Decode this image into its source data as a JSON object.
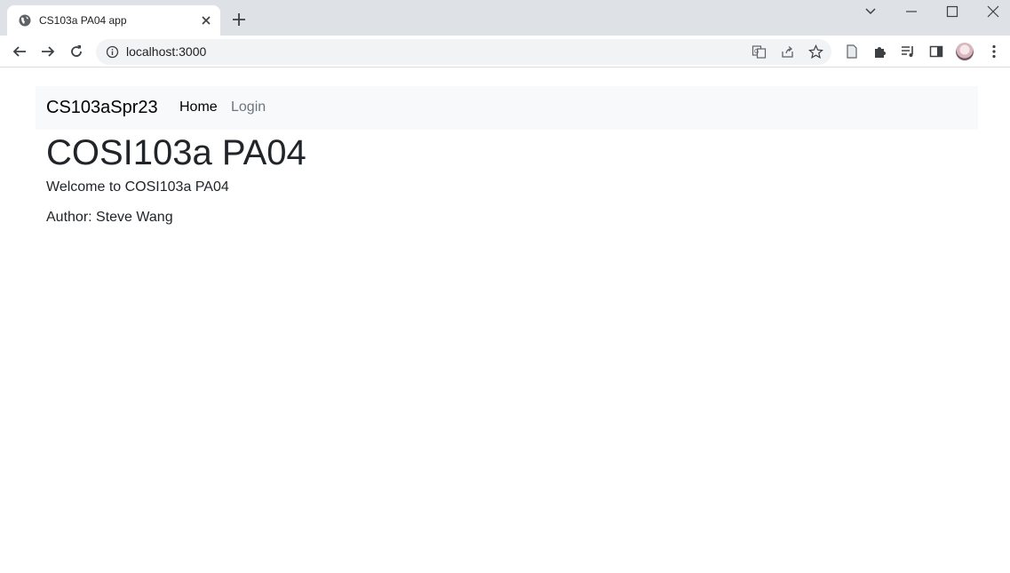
{
  "browser": {
    "tab_title": "CS103a PA04 app",
    "url": "localhost:3000"
  },
  "navbar": {
    "brand": "CS103aSpr23",
    "links": [
      {
        "label": "Home"
      },
      {
        "label": "Login"
      }
    ]
  },
  "main": {
    "title": "COSI103a PA04",
    "welcome": "Welcome to COSI103a PA04",
    "author": "Author: Steve Wang"
  }
}
